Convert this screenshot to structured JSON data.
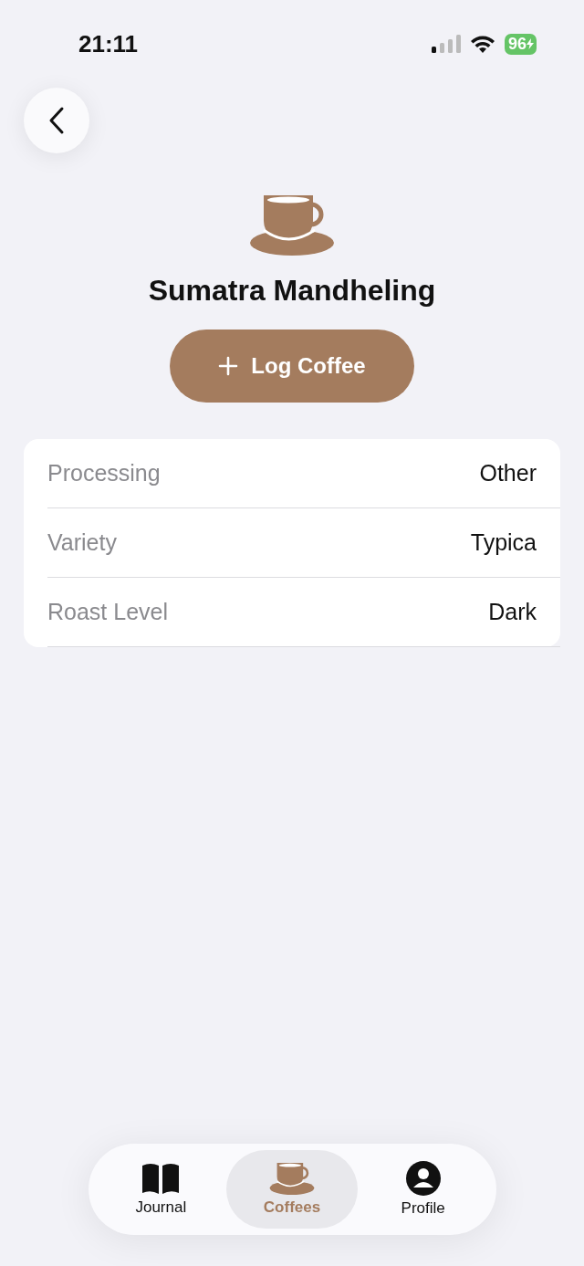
{
  "status_bar": {
    "time": "21:11",
    "battery": "96"
  },
  "coffee": {
    "name": "Sumatra Mandheling",
    "action": "Log Coffee"
  },
  "details": [
    {
      "label": "Processing",
      "value": "Other"
    },
    {
      "label": "Variety",
      "value": "Typica"
    },
    {
      "label": "Roast Level",
      "value": "Dark"
    }
  ],
  "tab_bar": [
    {
      "kind": "journal",
      "label": "Journal",
      "selected": false
    },
    {
      "kind": "coffees",
      "label": "Coffees",
      "selected": true
    },
    {
      "kind": "profile",
      "label": "Profile",
      "selected": false
    }
  ]
}
